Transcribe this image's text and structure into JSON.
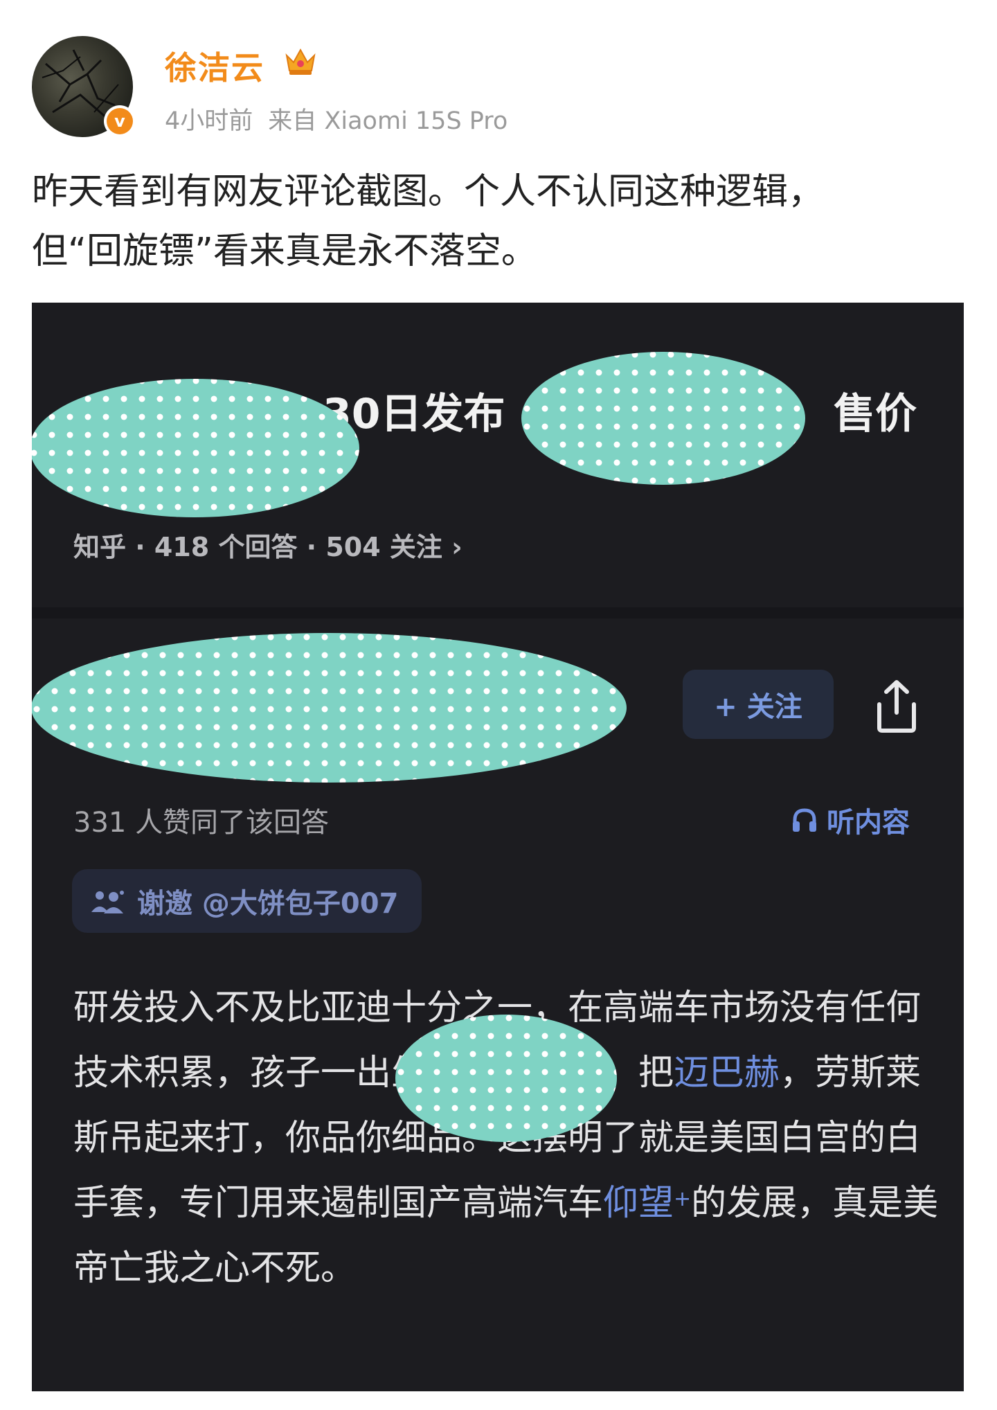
{
  "post": {
    "username": "徐洁云",
    "time": "4小时前",
    "source": "来自 Xiaomi 15S Pro",
    "verified_symbol": "v",
    "text_line1": "昨天看到有网友评论截图。个人不认同这种逻辑，",
    "text_line2": "但“回旋镖”看来真是永不落空。",
    "accent_color": "#f28b1a"
  },
  "screenshot": {
    "question_title_visible": "30日发布",
    "question_title_suffix": "售价",
    "question_meta": "知乎 · 418 个回答 · 504 关注 ›",
    "follow_label": "+ 关注",
    "agree_text": "331 人赞同了该回答",
    "listen_label": "听内容",
    "invite_text": "谢邀 @大饼包子007",
    "answer": {
      "seg1": "研发投入不及比亚迪十分之一，在高端车市场没有任何技术积累",
      "seg2": "，孩子一出生就是一米八，把",
      "link1": "迈巴赫",
      "seg3": "，劳斯莱斯吊起来打，你品你细品。这摆明了就是美国白宫的白手套，专门用来遏制国产高端汽车",
      "link2": "仰望",
      "sup": "+",
      "seg4": "的发展，真是美帝亡我之心不死。"
    },
    "redaction_color": "#7fd3c4"
  },
  "icons": {
    "crown": "crown-icon",
    "verified": "verified-badge-icon",
    "share": "share-icon",
    "headphones": "headphones-icon",
    "invite": "invite-people-icon"
  }
}
